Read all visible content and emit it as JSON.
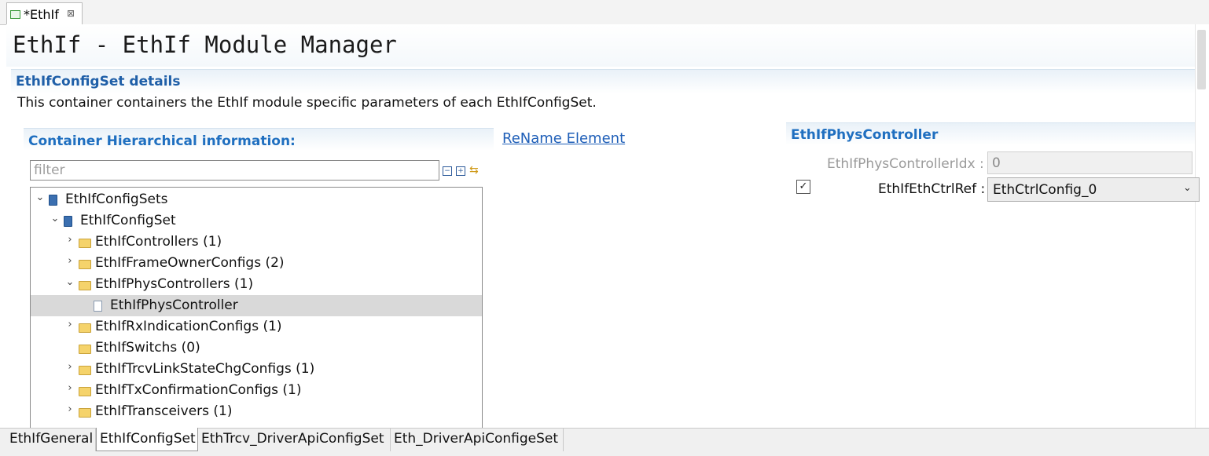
{
  "editor_tab": {
    "label": "*EthIf",
    "close_glyph": "⊠"
  },
  "header": {
    "title": "EthIf - EthIf Module Manager"
  },
  "details": {
    "title": "EthIfConfigSet details",
    "description": "This container containers the EthIf module specific parameters of each EthIfConfigSet."
  },
  "hierarchy": {
    "title": "Container Hierarchical information:",
    "filter_placeholder": "filter",
    "tree": [
      {
        "label": "EthIfConfigSets",
        "twisty": "⌄",
        "icon": "book-icon"
      },
      {
        "label": "EthIfConfigSet",
        "twisty": "⌄",
        "icon": "book-icon"
      },
      {
        "label": "EthIfControllers (1)",
        "twisty": "›",
        "icon": "folder-icon"
      },
      {
        "label": "EthIfFrameOwnerConfigs (2)",
        "twisty": "›",
        "icon": "folder-icon"
      },
      {
        "label": "EthIfPhysControllers (1)",
        "twisty": "⌄",
        "icon": "folder-icon"
      },
      {
        "label": "EthIfPhysController",
        "twisty": "",
        "icon": "leaf-icon",
        "selected": true
      },
      {
        "label": "EthIfRxIndicationConfigs (1)",
        "twisty": "›",
        "icon": "folder-icon"
      },
      {
        "label": "EthIfSwitchs (0)",
        "twisty": "",
        "icon": "folder-icon"
      },
      {
        "label": "EthIfTrcvLinkStateChgConfigs (1)",
        "twisty": "›",
        "icon": "folder-icon"
      },
      {
        "label": "EthIfTxConfirmationConfigs (1)",
        "twisty": "›",
        "icon": "folder-icon"
      },
      {
        "label": "EthIfTransceivers (1)",
        "twisty": "›",
        "icon": "folder-icon"
      }
    ]
  },
  "rename_link": "ReName Element",
  "phys_controller": {
    "title": "EthIfPhysController",
    "idx_label": "EthIfPhysControllerIdx :",
    "idx_value": "0",
    "ref_label": "EthIfEthCtrlRef :",
    "ref_value": "EthCtrlConfig_0",
    "ref_checked": true
  },
  "bottom_tabs": [
    "EthIfGeneral",
    "EthIfConfigSet",
    "EthTrcv_DriverApiConfigSet",
    "Eth_DriverApiConfigeSet"
  ],
  "colors": {
    "accent": "#1f6fc0",
    "link": "#1f5fb8",
    "selection": "#d9d9d9",
    "folder": "#f5d36b"
  }
}
